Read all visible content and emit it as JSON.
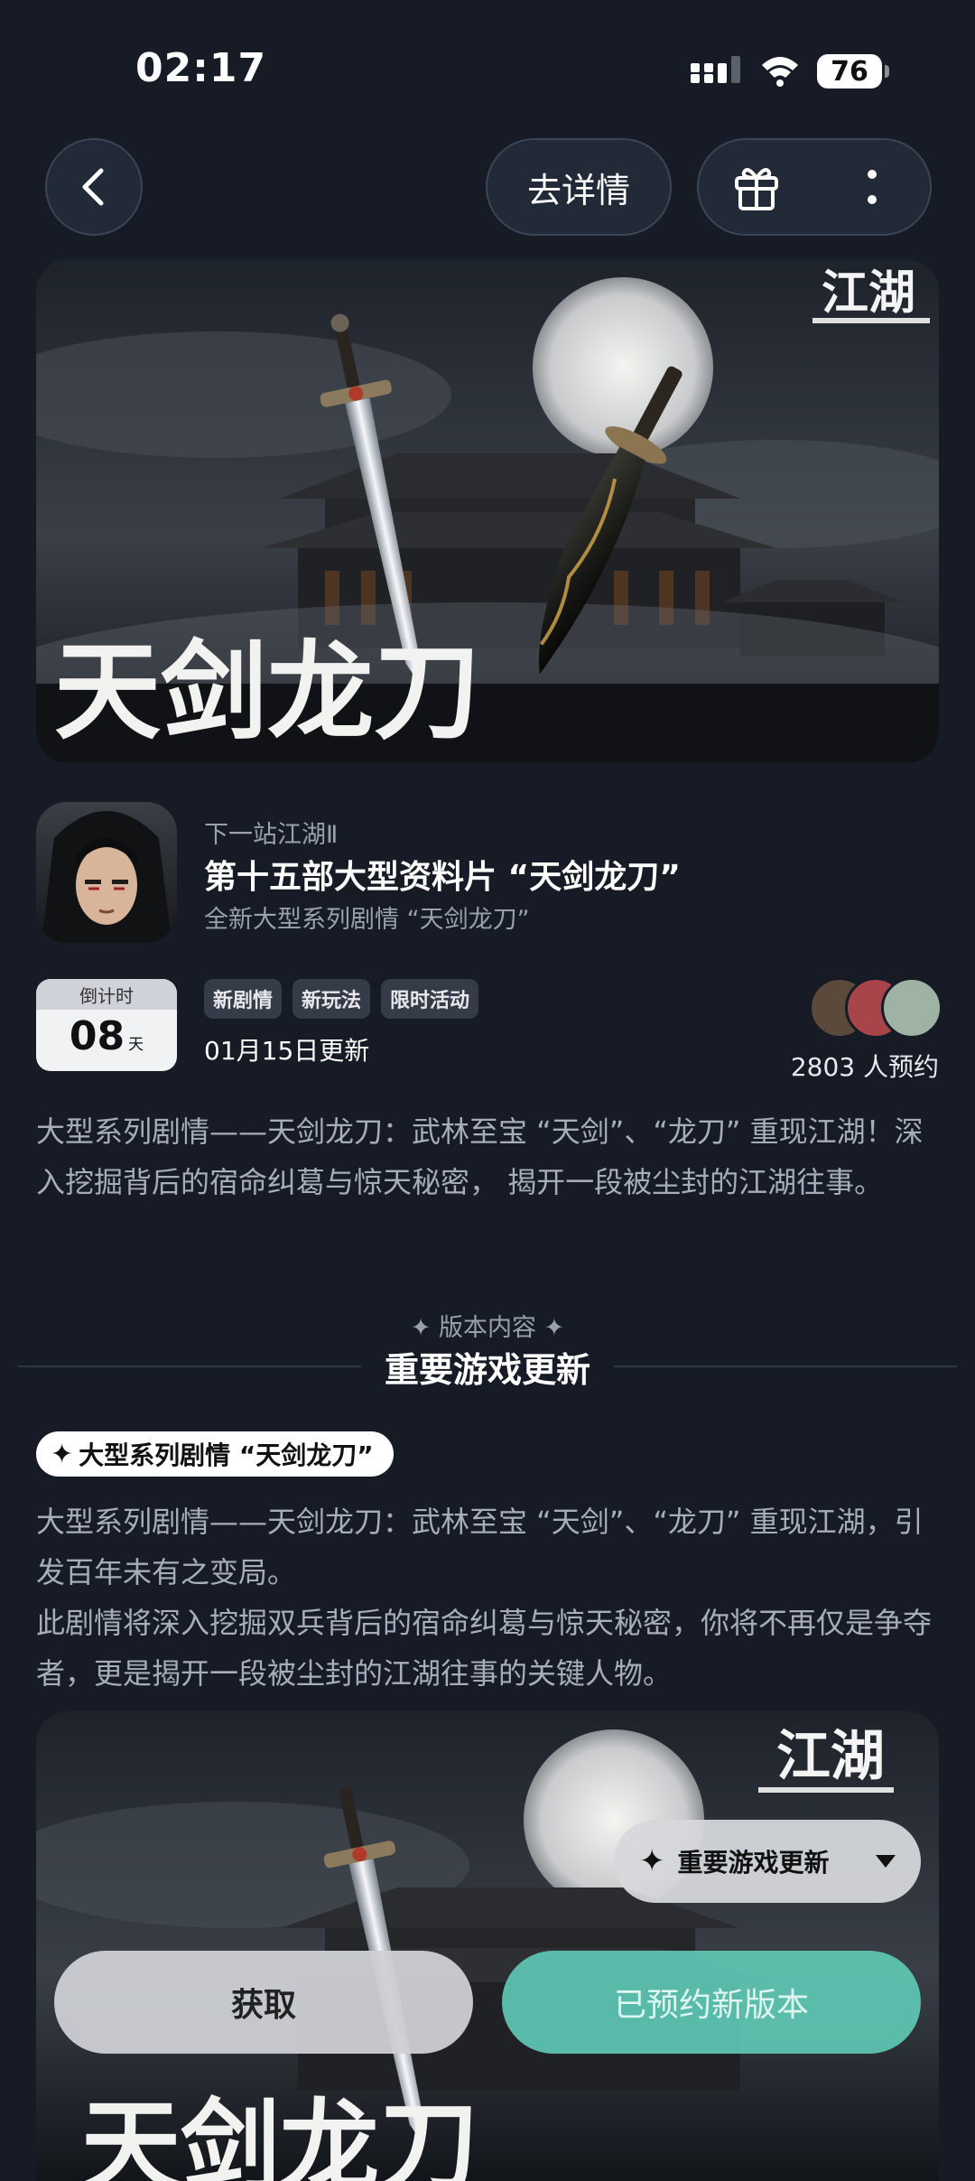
{
  "status_bar": {
    "time": "02:17",
    "battery": "76"
  },
  "nav": {
    "detail_label": "去详情"
  },
  "hero": {
    "calligraphy_title": "天剑龙刀",
    "logo_text": "江湖"
  },
  "game": {
    "series": "下一站江湖Ⅱ",
    "title": "第十五部大型资料片 “天剑龙刀”",
    "subtitle": "全新大型系列剧情 “天剑龙刀”"
  },
  "countdown": {
    "label": "倒计时",
    "days": "08",
    "unit": "天"
  },
  "tags": [
    "新剧情",
    "新玩法",
    "限时活动"
  ],
  "update_date": "01月15日更新",
  "reservations": "2803 人预约",
  "intro": "大型系列剧情——天剑龙刀：武林至宝 “天剑”、“龙刀” 重现江湖！深入挖掘背后的宿命纠葛与惊天秘密， 揭开一段被尘封的江湖往事。",
  "section": {
    "label": "版本内容",
    "title": "重要游戏更新"
  },
  "feature": {
    "pill": "大型系列剧情 “天剑龙刀”",
    "p1": "大型系列剧情——天剑龙刀：武林至宝 “天剑”、“龙刀” 重现江湖，引发百年未有之变局。",
    "p2": "此剧情将深入挖掘双兵背后的宿命纠葛与惊天秘密，你将不再仅是争夺者，更是揭开一段被尘封的江湖往事的关键人物。"
  },
  "floating": {
    "section_switch": "重要游戏更新"
  },
  "actions": {
    "get": "获取",
    "reserved": "已预约新版本"
  },
  "colors": {
    "background": "#161b26",
    "accent": "#5fc8b4"
  }
}
